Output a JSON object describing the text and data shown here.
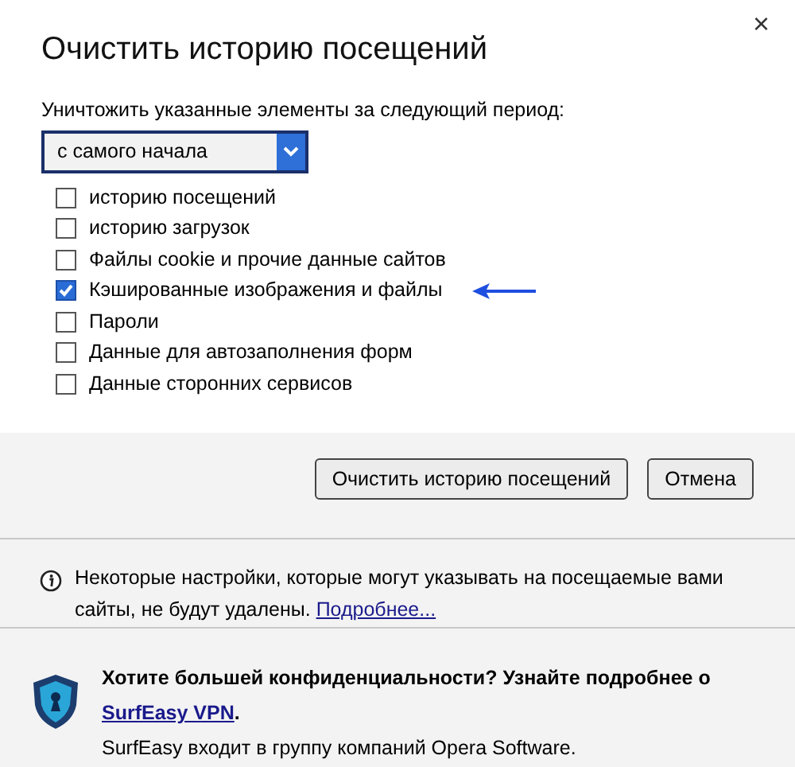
{
  "dialog": {
    "title": "Очистить историю посещений",
    "close": "×"
  },
  "period": {
    "label": "Уничтожить указанные элементы за следующий период:",
    "value": "с самого начала"
  },
  "items": [
    {
      "label": "историю посещений",
      "checked": false,
      "pointed": false
    },
    {
      "label": "историю загрузок",
      "checked": false,
      "pointed": false
    },
    {
      "label": "Файлы cookie и прочие данные сайтов",
      "checked": false,
      "pointed": false
    },
    {
      "label": "Кэшированные изображения и файлы",
      "checked": true,
      "pointed": true
    },
    {
      "label": "Пароли",
      "checked": false,
      "pointed": false
    },
    {
      "label": "Данные для автозаполнения форм",
      "checked": false,
      "pointed": false
    },
    {
      "label": "Данные сторонних сервисов",
      "checked": false,
      "pointed": false
    }
  ],
  "buttons": [
    {
      "label": "Очистить историю посещений"
    },
    {
      "label": "Отмена"
    }
  ],
  "notice": {
    "text": "Некоторые настройки, которые могут указывать на посещаемые вами сайты, не будут удалены.",
    "link": "Подробнее..."
  },
  "promo": {
    "heading": "Хотите большей конфиденциальности? Узнайте подробнее о",
    "link": "SurfEasy VPN",
    "after": ".",
    "note": "SurfEasy входит в группу компаний Opera Software."
  }
}
